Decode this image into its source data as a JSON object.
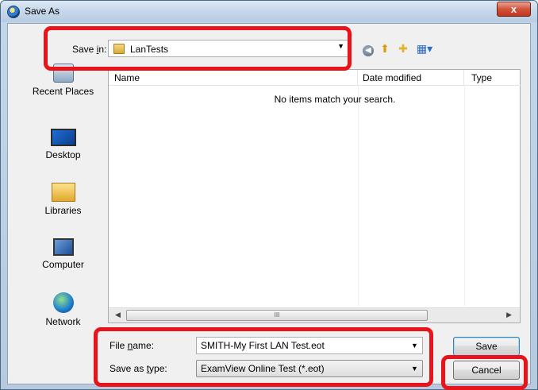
{
  "window": {
    "title": "Save As",
    "close_label": "x"
  },
  "toolbar": {
    "save_in_label_pre": "Save ",
    "save_in_label_u": "i",
    "save_in_label_post": "n:",
    "save_in_value": "LanTests",
    "icons": [
      "back-icon",
      "up-folder-icon",
      "new-folder-icon",
      "views-menu-icon"
    ]
  },
  "places": [
    {
      "label": "Recent Places",
      "icon": "recent-places-icon"
    },
    {
      "label": "Desktop",
      "icon": "desktop-icon"
    },
    {
      "label": "Libraries",
      "icon": "libraries-icon"
    },
    {
      "label": "Computer",
      "icon": "computer-icon"
    },
    {
      "label": "Network",
      "icon": "network-icon"
    }
  ],
  "filelist": {
    "columns": [
      "Name",
      "Date modified",
      "Type"
    ],
    "empty_message": "No items match your search.",
    "scroll_grip": "III"
  },
  "form": {
    "file_name_label_pre": "File ",
    "file_name_label_u": "n",
    "file_name_label_post": "ame:",
    "file_name_value": "SMITH-My First LAN Test.eot",
    "save_as_type_label_pre": "Save as ",
    "save_as_type_label_u": "t",
    "save_as_type_label_post": "ype:",
    "save_as_type_value": "ExamView Online Test (*.eot)"
  },
  "buttons": {
    "save": "Save",
    "cancel": "Cancel"
  },
  "colors": {
    "annotation": "#e8131b",
    "title_bar": "#c5d7ea",
    "close_button": "#c1371e"
  }
}
